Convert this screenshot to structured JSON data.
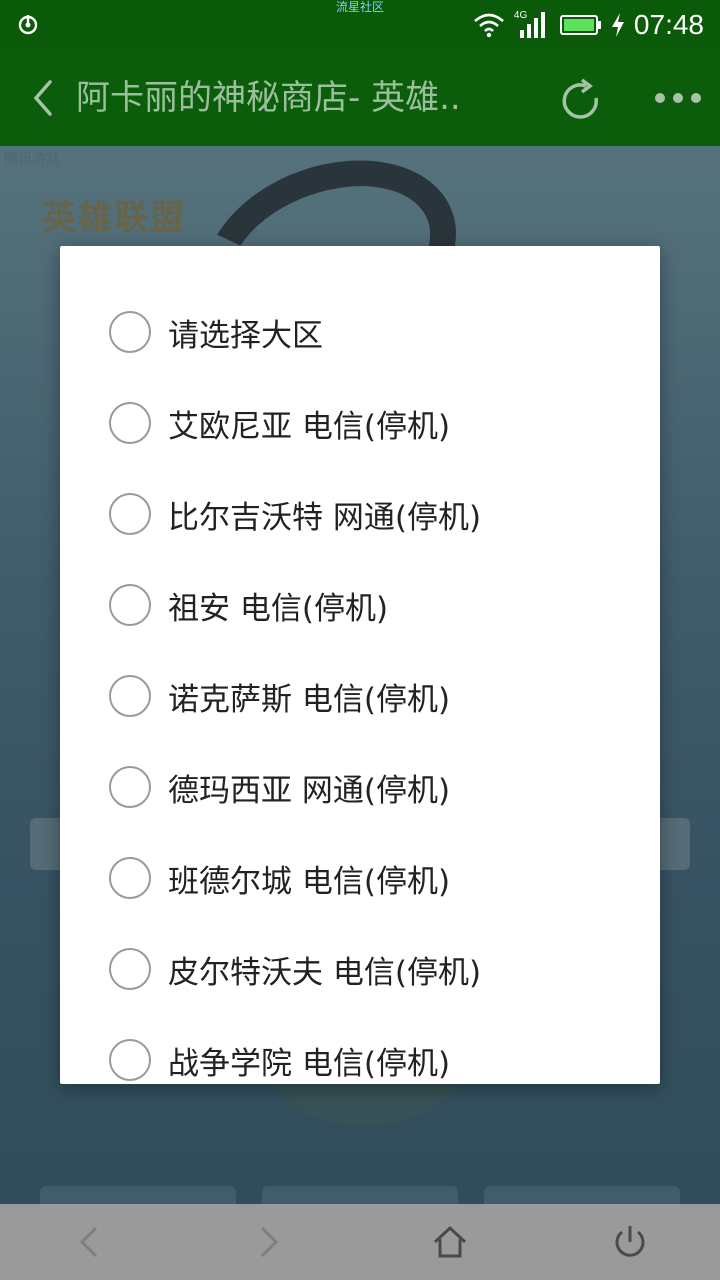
{
  "status_bar": {
    "carrier_text": "流星社区",
    "network": "4G",
    "time": "07:48",
    "icons": [
      "app-notification-icon",
      "wifi-icon",
      "signal-icon",
      "battery-icon",
      "charging-icon"
    ]
  },
  "app_bar": {
    "title": "阿卡丽的神秘商店- 英雄..",
    "icons": [
      "back-arrow-icon",
      "refresh-icon",
      "more-dots-icon"
    ]
  },
  "background": {
    "logo_text": "英雄联盟",
    "top_text": "腾讯游戏"
  },
  "dialog": {
    "options": [
      {
        "label": "请选择大区",
        "selected": false
      },
      {
        "label": "艾欧尼亚 电信(停机)",
        "selected": false
      },
      {
        "label": "比尔吉沃特 网通(停机)",
        "selected": false
      },
      {
        "label": "祖安 电信(停机)",
        "selected": false
      },
      {
        "label": "诺克萨斯 电信(停机)",
        "selected": false
      },
      {
        "label": "德玛西亚 网通(停机)",
        "selected": false
      },
      {
        "label": "班德尔城 电信(停机)",
        "selected": false
      },
      {
        "label": "皮尔特沃夫 电信(停机)",
        "selected": false
      },
      {
        "label": "战争学院 电信(停机)",
        "selected": false
      }
    ]
  },
  "bottom_nav": {
    "icons": [
      "nav-back-icon",
      "nav-forward-icon",
      "home-icon",
      "power-icon"
    ]
  },
  "colors": {
    "status_bar": "#0a5a0a",
    "app_bar": "#0b5d0b",
    "title_text": "#9bbf9b",
    "radio_border": "#9a9a9a",
    "bottom_bar": "#9a9a9a"
  }
}
